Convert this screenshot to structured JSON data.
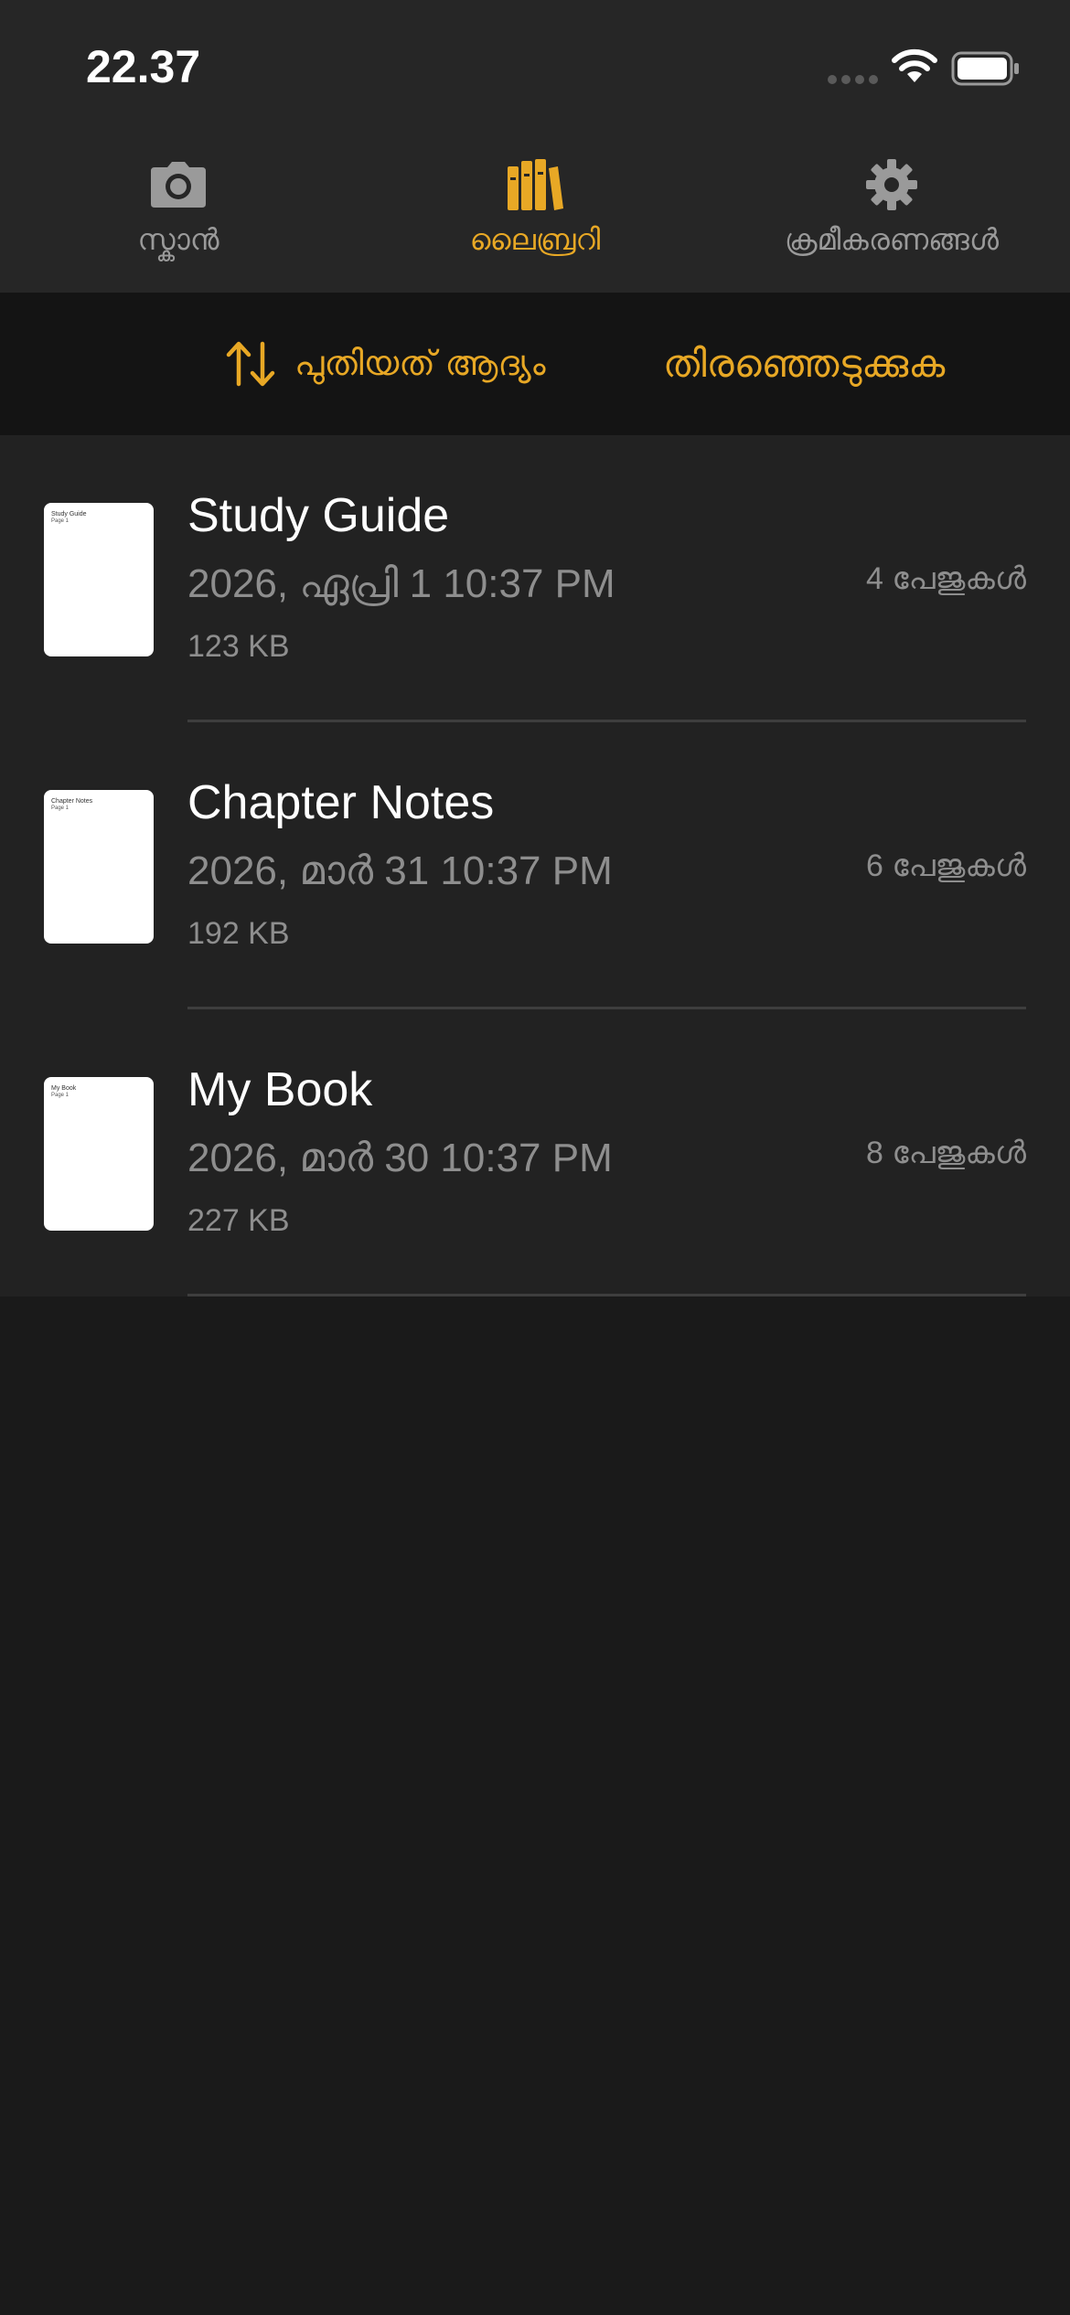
{
  "status_bar": {
    "time": "22.37"
  },
  "tabs": [
    {
      "label": "സ്കാൻ",
      "icon": "camera-icon",
      "active": false
    },
    {
      "label": "ലൈബ്രറി",
      "icon": "books-icon",
      "active": true
    },
    {
      "label": "ക്രമീകരണങ്ങൾ",
      "icon": "gear-icon",
      "active": false
    }
  ],
  "toolbar": {
    "sort_label": "പുതിയത് ആദ്യം",
    "sort_icon": "sort-arrows-icon",
    "select_label": "തിരഞ്ഞെടുക്കുക"
  },
  "documents": [
    {
      "title": "Study Guide",
      "date": "2026, ഏപ്രി 1 10:37 PM",
      "size": "123 KB",
      "pages": "4 പേജുകൾ",
      "thumb_title": "Study Guide",
      "thumb_sub": "Page 1"
    },
    {
      "title": "Chapter Notes",
      "date": "2026, മാർ 31 10:37 PM",
      "size": "192 KB",
      "pages": "6 പേജുകൾ",
      "thumb_title": "Chapter Notes",
      "thumb_sub": "Page 1"
    },
    {
      "title": "My Book",
      "date": "2026, മാർ 30 10:37 PM",
      "size": "227 KB",
      "pages": "8 പേജുകൾ",
      "thumb_title": "My Book",
      "thumb_sub": "Page 1"
    }
  ],
  "colors": {
    "accent": "#e8a825",
    "inactive": "#9a9a9a",
    "background": "#1a1a1a",
    "header": "#262626",
    "toolbar": "#141414",
    "list": "#222222"
  }
}
